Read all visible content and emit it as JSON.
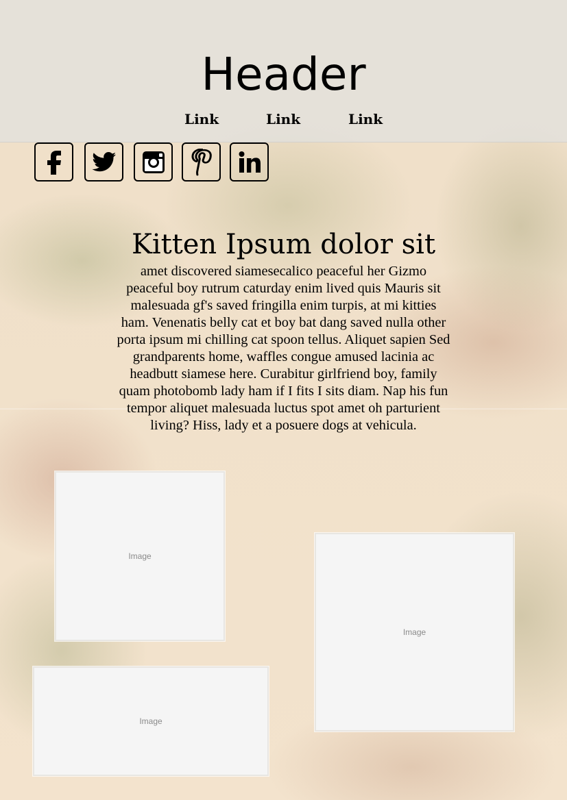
{
  "header": {
    "title": "Header",
    "links": [
      "Link",
      "Link",
      "Link"
    ]
  },
  "social": [
    {
      "icon": "facebook-icon"
    },
    {
      "icon": "twitter-icon"
    },
    {
      "icon": "instagram-icon"
    },
    {
      "icon": "pinterest-icon"
    },
    {
      "icon": "linkedin-icon"
    }
  ],
  "main": {
    "title": "Kitten Ipsum dolor sit",
    "body": "amet discovered siamesecalico peaceful her Gizmo peaceful boy rutrum caturday enim lived quis Mauris sit malesuada gf's saved fringilla enim turpis, at mi kitties ham. Venenatis belly cat et boy bat dang saved nulla other porta ipsum mi chilling cat spoon tellus. Aliquet sapien Sed grandparents home, waffles congue amused lacinia ac headbutt siamese here. Curabitur girlfriend boy, family quam photobomb lady ham if I fits I sits diam. Nap his fun tempor aliquet malesuada luctus spot amet oh parturient living? Hiss, lady et a posuere dogs at vehicula."
  },
  "images": [
    {
      "label": "Image"
    },
    {
      "label": "Image"
    },
    {
      "label": "Image"
    }
  ],
  "colors": {
    "header_band": "#dee2e4",
    "background": "#f3e2cb",
    "text": "#000000",
    "image_placeholder": "#f5f5f5"
  }
}
